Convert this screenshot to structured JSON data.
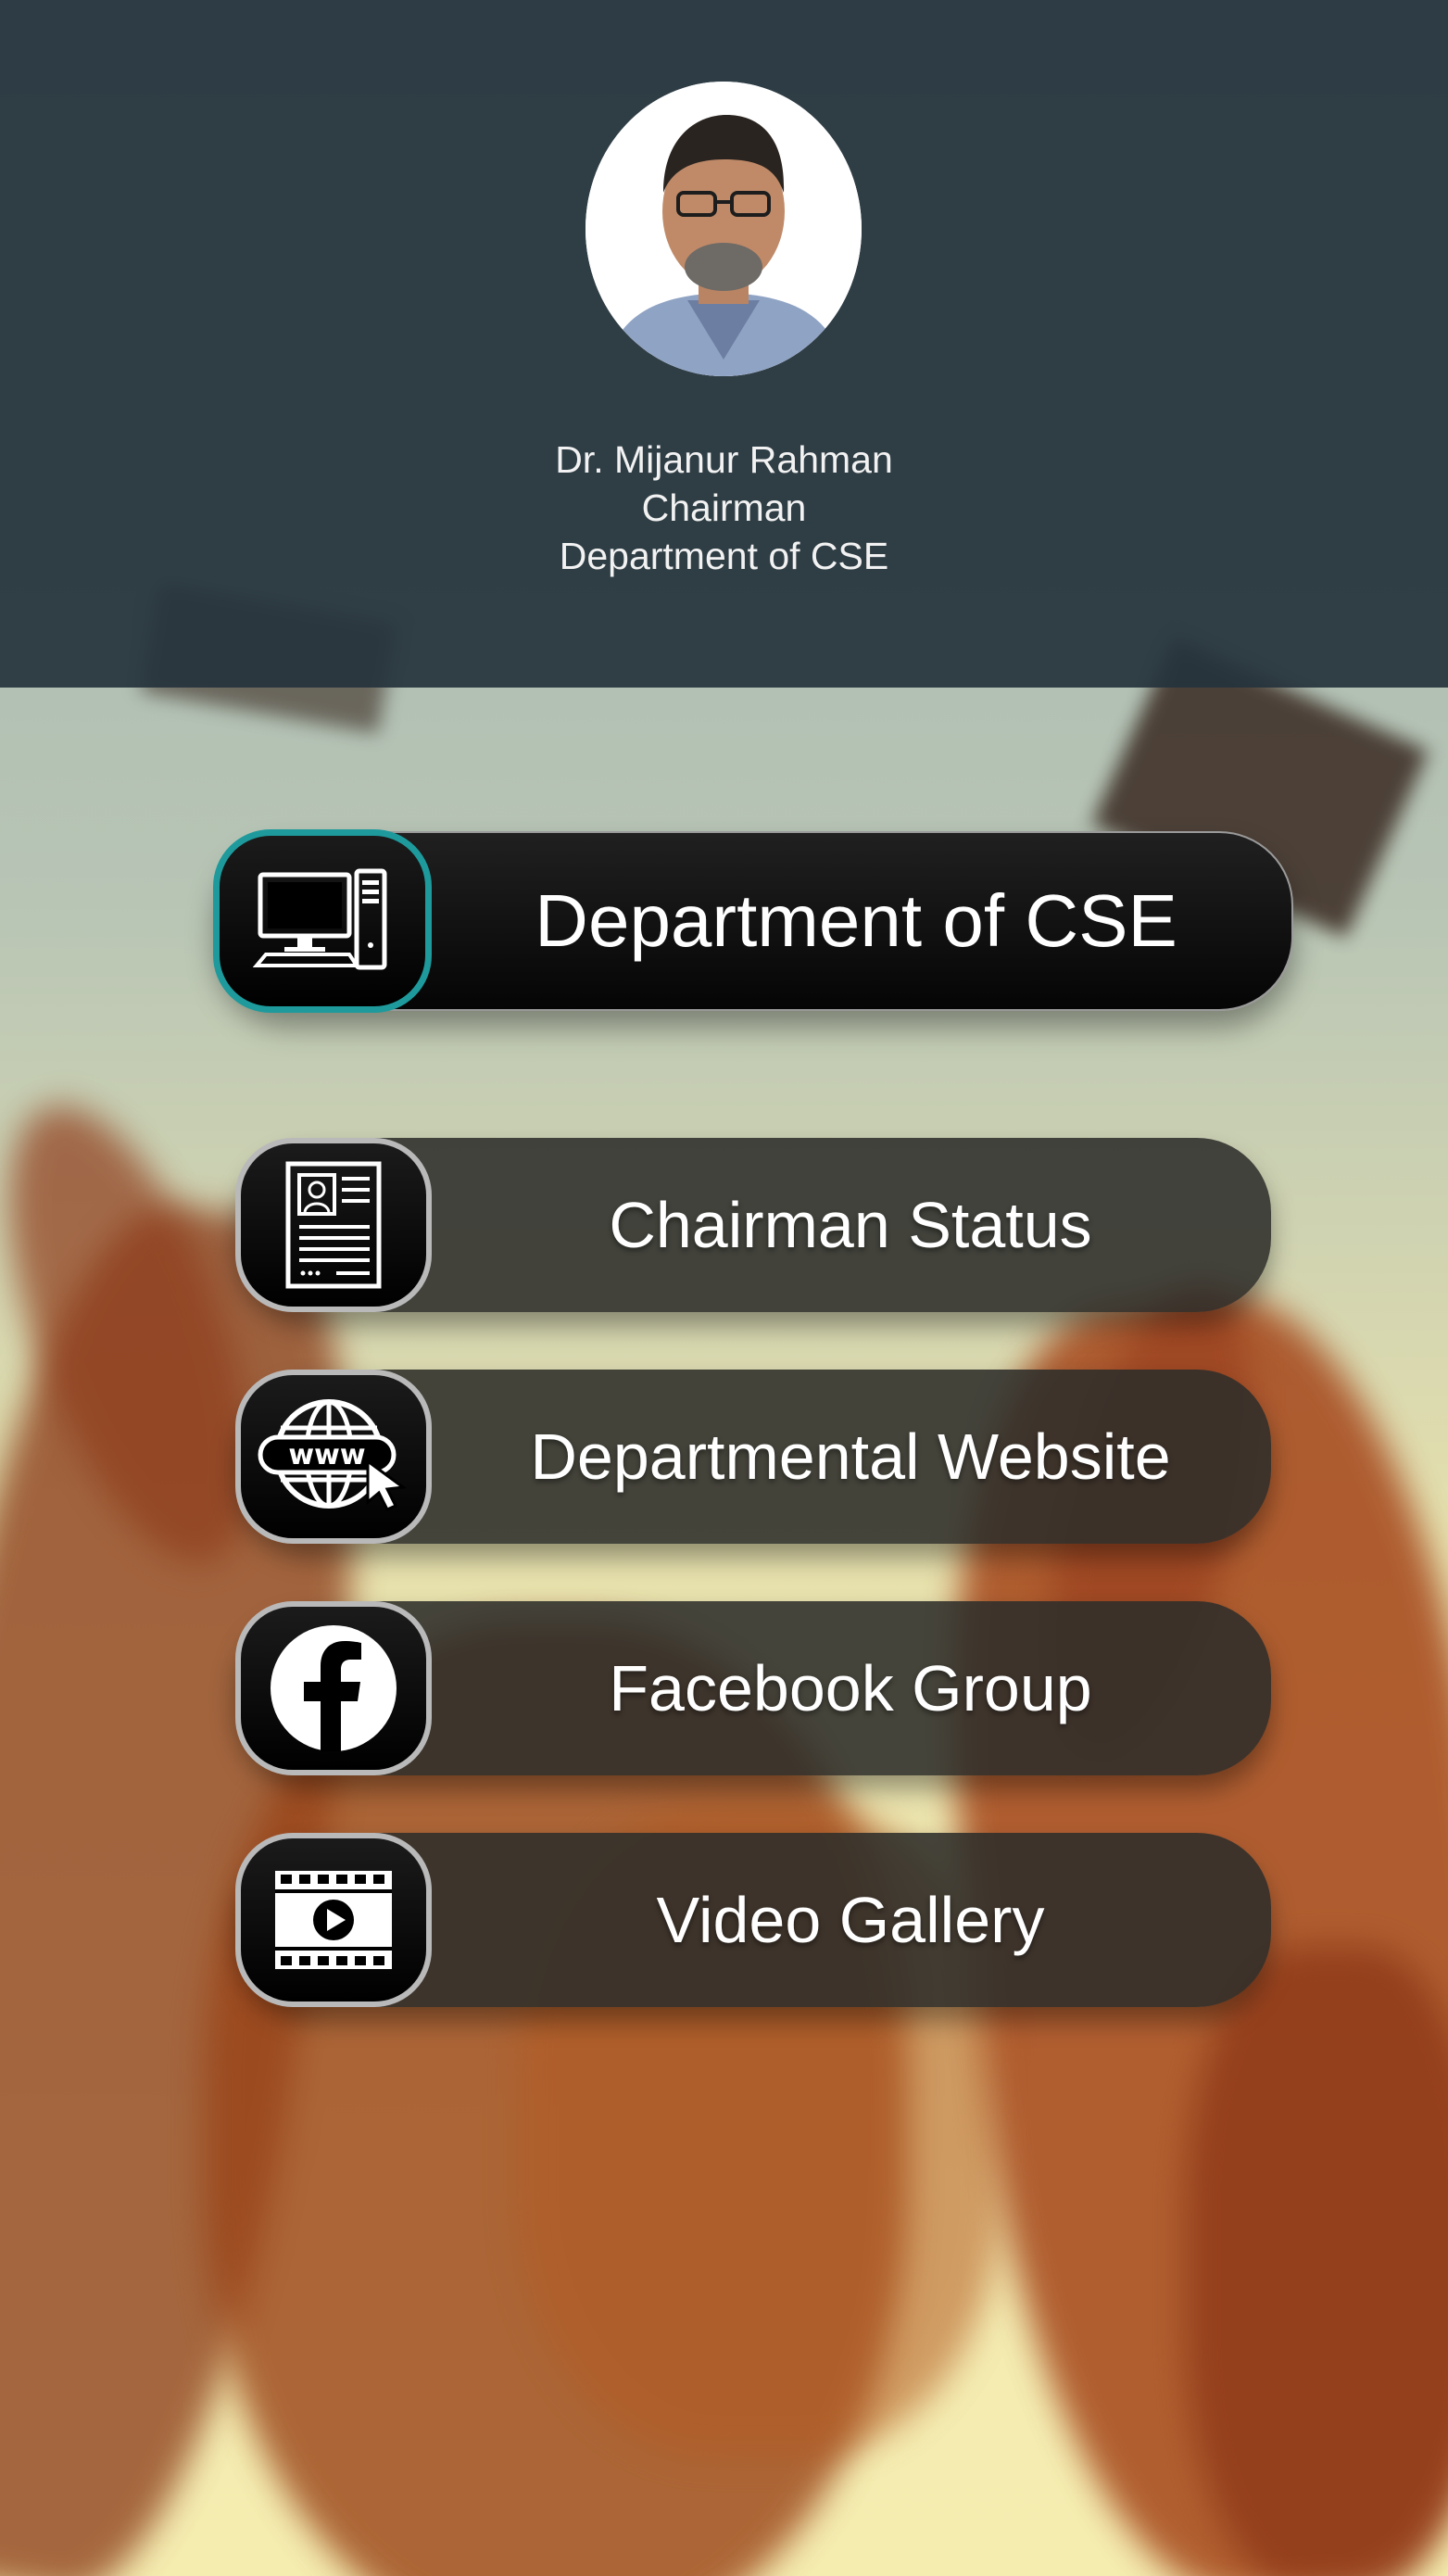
{
  "profile": {
    "name": "Dr. Mijanur Rahman",
    "role": "Chairman",
    "department": "Department of CSE"
  },
  "menu": {
    "primary": {
      "label": "Department of CSE",
      "icon": "computer-icon"
    },
    "items": [
      {
        "label": "Chairman Status",
        "icon": "profile-document-icon"
      },
      {
        "label": "Departmental Website",
        "icon": "www-globe-icon"
      },
      {
        "label": "Facebook Group",
        "icon": "facebook-icon"
      },
      {
        "label": "Video Gallery",
        "icon": "video-film-icon"
      }
    ]
  },
  "colors": {
    "header_bg": "#26343c",
    "accent": "#1e9a9c",
    "button_bg": "#2d2d2a"
  }
}
